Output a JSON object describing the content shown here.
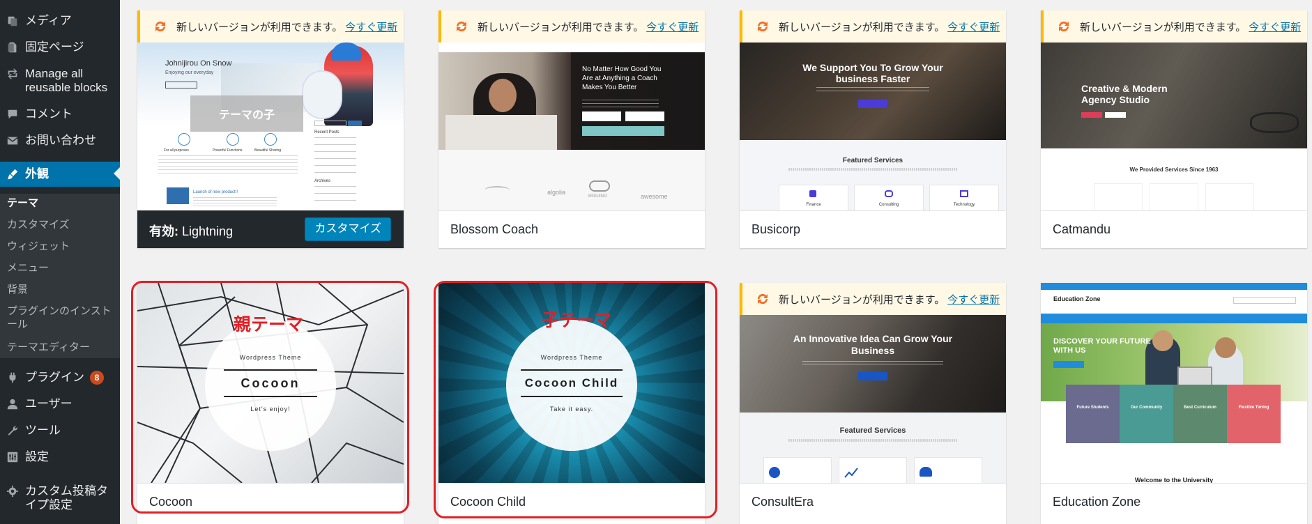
{
  "sidebar": {
    "items": [
      {
        "label": "メディア",
        "icon": "media-icon"
      },
      {
        "label": "固定ページ",
        "icon": "page-icon"
      },
      {
        "label": "Manage all reusable blocks",
        "icon": "blocks-icon"
      },
      {
        "label": "コメント",
        "icon": "comment-icon"
      },
      {
        "label": "お問い合わせ",
        "icon": "mail-icon"
      },
      {
        "label": "外観",
        "icon": "brush-icon"
      }
    ],
    "appearance_submenu": [
      "テーマ",
      "カスタマイズ",
      "ウィジェット",
      "メニュー",
      "背景",
      "プラグインのインストール",
      "テーマエディター"
    ],
    "items_after": [
      {
        "label": "プラグイン",
        "icon": "plugin-icon",
        "badge": "8"
      },
      {
        "label": "ユーザー",
        "icon": "user-icon"
      },
      {
        "label": "ツール",
        "icon": "wrench-icon"
      },
      {
        "label": "設定",
        "icon": "settings-icon"
      },
      {
        "label": "カスタム投稿タイプ設定",
        "icon": "gear-icon"
      }
    ]
  },
  "update_notice": {
    "text": "新しいバージョンが利用できます。",
    "link": "今すぐ更新"
  },
  "themes": {
    "lightning": {
      "name": "Lightning",
      "active_prefix": "有効: ",
      "customize_label": "カスタマイズ",
      "shot_title": "Johnijirou On Snow",
      "shot_subtitle": "Enjoying our everyday",
      "shot_overlay": "テーマの子",
      "shot_col_labels": [
        "For all purposes",
        "Powerful Functions",
        "Beautiful Sharing"
      ],
      "shot_side_title": "Recent Posts",
      "shot_side_title2": "Archives",
      "shot_post_title": "Launch of new product!!"
    },
    "blossom": {
      "name": "Blossom Coach",
      "shot_headline": "No Matter How Good You Are at Anything a Coach Makes You Better",
      "shot_logos": [
        "algolia",
        "ARDUINO",
        "awesome"
      ]
    },
    "busicorp": {
      "name": "Busicorp",
      "shot_headline": "We Support You To Grow Your business Faster",
      "shot_section": "Featured Services",
      "shot_services": [
        "Finance",
        "Consulting",
        "Technology"
      ]
    },
    "catmandu": {
      "name": "Catmandu",
      "shot_headline": "Creative & Modern Agency Studio",
      "shot_section": "We Provided Services Since 1963"
    },
    "cocoon": {
      "name": "Cocoon",
      "annotation": "親テーマ",
      "shot_small": "Wordpress Theme",
      "shot_big": "Cocoon",
      "shot_tag": "Let's enjoy!"
    },
    "cocoon_child": {
      "name": "Cocoon Child",
      "annotation": "子テーマ",
      "shot_small": "Wordpress Theme",
      "shot_big": "Cocoon Child",
      "shot_tag": "Take it easy."
    },
    "consultera": {
      "name": "ConsultEra",
      "shot_headline": "An Innovative Idea Can Grow Your Business",
      "shot_section": "Featured Services"
    },
    "education_zone": {
      "name": "Education Zone",
      "shot_logo": "Education Zone",
      "shot_headline": "DISCOVER YOUR FUTURE WITH US",
      "shot_tiles": [
        "Future Students",
        "Our Community",
        "Best Curriculum",
        "Flexible Timing"
      ],
      "shot_footer": "Welcome to the University"
    }
  },
  "colors": {
    "sidebar_bg": "#23282d",
    "submenu_bg": "#32373c",
    "current_menu": "#0073aa",
    "notice_border": "#ffb900",
    "annotation_red": "#e21f26",
    "customize_button": "#0085ba"
  }
}
